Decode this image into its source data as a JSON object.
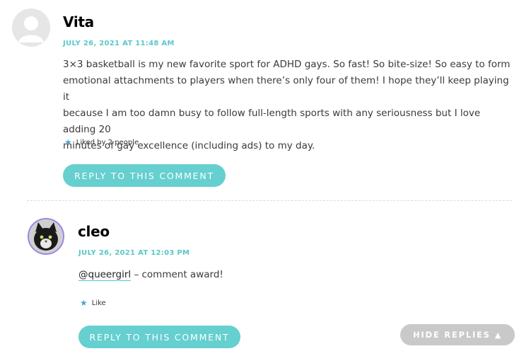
{
  "comments": [
    {
      "author": "Vita",
      "date": "JULY 26, 2021 AT 11:48 AM",
      "text_lines": [
        "3×3 basketball is my new favorite sport for ADHD gays. So fast! So bite-size! So easy to form",
        "emotional attachments to players when there’s only four of them! I hope they’ll keep playing it",
        "because I am too damn busy to follow full-length sports with any seriousness but I love adding 20",
        "minutes of gay excellence (including ads) to my day."
      ],
      "likes": "Liked by 2 people",
      "reply_label": "REPLY TO THIS COMMENT"
    },
    {
      "author": "cleo",
      "date": "JULY 26, 2021 AT 12:03 PM",
      "mention": "@queergirl",
      "text_rest": " – comment award!",
      "likes": "Like",
      "reply_label": "REPLY TO THIS COMMENT"
    }
  ],
  "hide_replies_label": "HIDE REPLIES",
  "icons": {
    "like": "star-icon",
    "hide": "triangle-up-icon"
  },
  "colors": {
    "accent": "#66cfcf",
    "date": "#5ac8c8",
    "avatar_ring": "#9d84e6"
  }
}
